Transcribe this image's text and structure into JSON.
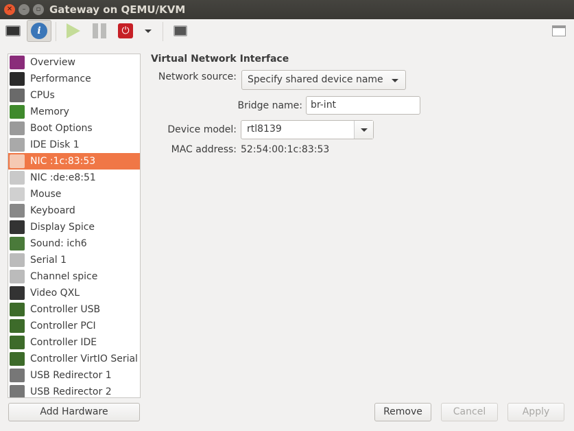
{
  "window": {
    "title": "Gateway on QEMU/KVM"
  },
  "toolbar": {
    "buttons": [
      "console-icon",
      "info-icon",
      "run-icon",
      "pause-icon",
      "shutdown-icon",
      "dropdown-icon",
      "snapshots-icon",
      "fullscreen-icon"
    ]
  },
  "sidebar": {
    "items": [
      {
        "label": "Overview",
        "icon": "overview-icon",
        "color": "#8a2c7a"
      },
      {
        "label": "Performance",
        "icon": "performance-icon",
        "color": "#2b2b2b"
      },
      {
        "label": "CPUs",
        "icon": "cpu-icon",
        "color": "#6a6a6a"
      },
      {
        "label": "Memory",
        "icon": "memory-icon",
        "color": "#3f8a2c"
      },
      {
        "label": "Boot Options",
        "icon": "boot-options-icon",
        "color": "#9a9a9a"
      },
      {
        "label": "IDE Disk 1",
        "icon": "disk-icon",
        "color": "#a9a9a9"
      },
      {
        "label": "NIC :1c:83:53",
        "icon": "nic-icon",
        "color": "#f5c9b3"
      },
      {
        "label": "NIC :de:e8:51",
        "icon": "nic-icon",
        "color": "#c9c9c9"
      },
      {
        "label": "Mouse",
        "icon": "mouse-icon",
        "color": "#d0d0d0"
      },
      {
        "label": "Keyboard",
        "icon": "keyboard-icon",
        "color": "#888"
      },
      {
        "label": "Display Spice",
        "icon": "display-icon",
        "color": "#333"
      },
      {
        "label": "Sound: ich6",
        "icon": "sound-icon",
        "color": "#4a7a3a"
      },
      {
        "label": "Serial 1",
        "icon": "serial-icon",
        "color": "#bbb"
      },
      {
        "label": "Channel spice",
        "icon": "channel-icon",
        "color": "#bbb"
      },
      {
        "label": "Video QXL",
        "icon": "video-icon",
        "color": "#333"
      },
      {
        "label": "Controller USB",
        "icon": "controller-icon",
        "color": "#3d6b2a"
      },
      {
        "label": "Controller PCI",
        "icon": "controller-icon",
        "color": "#3d6b2a"
      },
      {
        "label": "Controller IDE",
        "icon": "controller-icon",
        "color": "#3d6b2a"
      },
      {
        "label": "Controller VirtIO Serial",
        "icon": "controller-icon",
        "color": "#3d6b2a"
      },
      {
        "label": "USB Redirector 1",
        "icon": "usb-icon",
        "color": "#777"
      },
      {
        "label": "USB Redirector 2",
        "icon": "usb-icon",
        "color": "#777"
      }
    ],
    "selected_index": 6,
    "selected_color": "#f07746"
  },
  "main": {
    "section_title": "Virtual Network Interface",
    "network_source_label": "Network source:",
    "network_source_value": "Specify shared device name",
    "bridge_label": "Bridge name:",
    "bridge_value": "br-int",
    "device_model_label": "Device model:",
    "device_model_value": "rtl8139",
    "mac_label": "MAC address:",
    "mac_value": "52:54:00:1c:83:53"
  },
  "buttons": {
    "add_hardware": "Add Hardware",
    "remove": "Remove",
    "cancel": "Cancel",
    "apply": "Apply"
  }
}
